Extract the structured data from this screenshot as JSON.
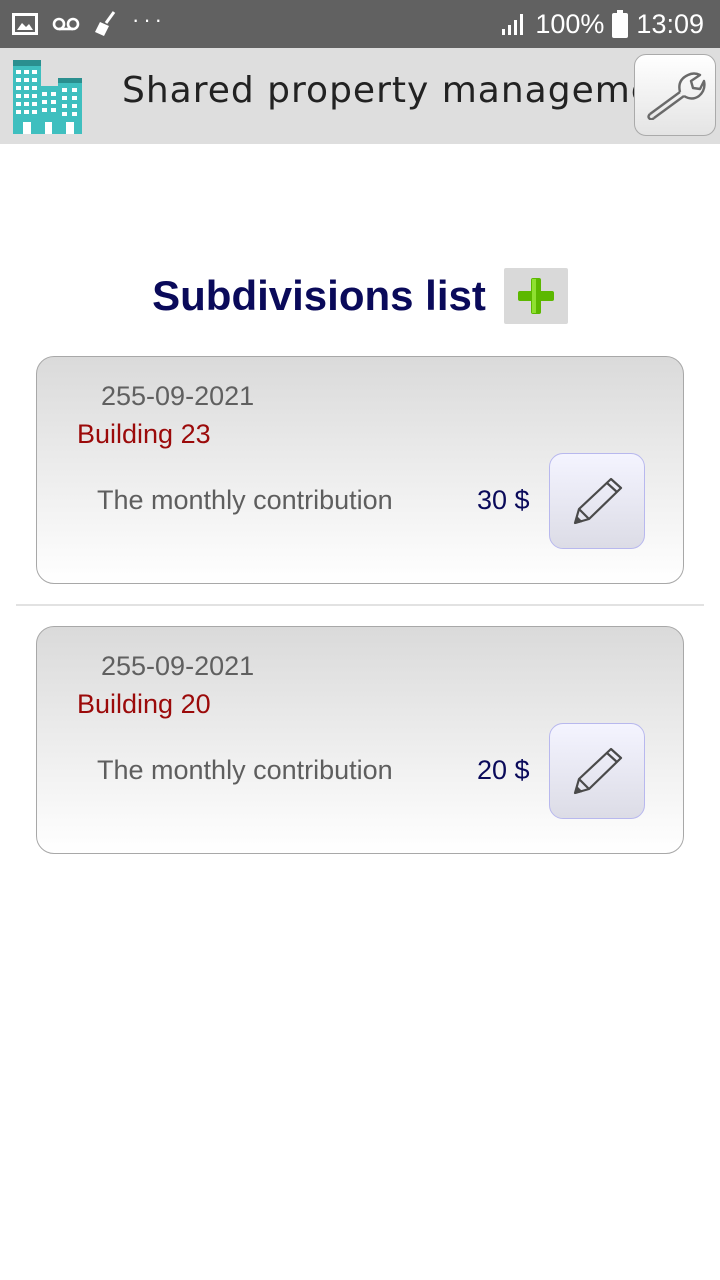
{
  "status_bar": {
    "icons_left": [
      "image-icon",
      "voicemail-icon",
      "broom-icon"
    ],
    "more": "···",
    "battery": "100%",
    "time": "13:09"
  },
  "app_bar": {
    "title": "Shared property management",
    "settings_icon": "wrench-icon"
  },
  "list": {
    "title": "Subdivisions list",
    "add_icon": "plus-icon",
    "items": [
      {
        "date": "255-09-2021",
        "name": "Building 23",
        "label": "The monthly contribution",
        "amount": "30 $"
      },
      {
        "date": "255-09-2021",
        "name": "Building 20",
        "label": "The monthly contribution",
        "amount": "20 $"
      }
    ]
  },
  "colors": {
    "status_bar": "#616161",
    "app_bar": "#dedede",
    "title": "#0a0a5a",
    "building_name": "#9b0a0a",
    "add_icon": "#5cb800"
  }
}
